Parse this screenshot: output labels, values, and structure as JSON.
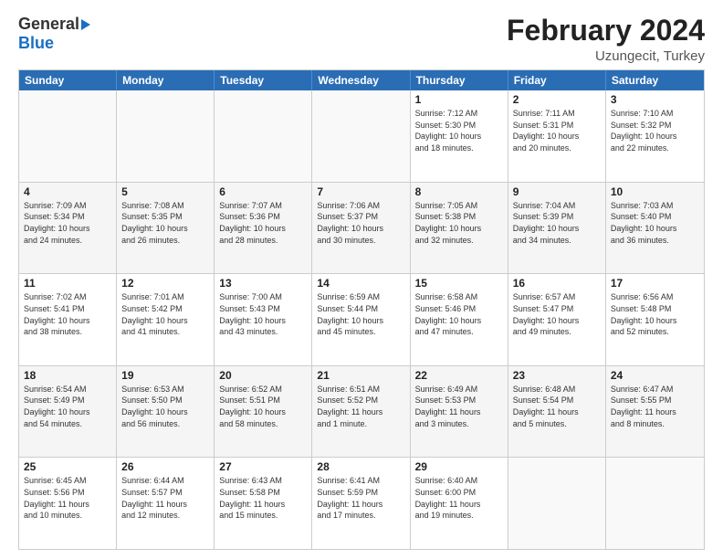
{
  "logo": {
    "general": "General",
    "blue": "Blue"
  },
  "title": "February 2024",
  "subtitle": "Uzungecit, Turkey",
  "days_of_week": [
    "Sunday",
    "Monday",
    "Tuesday",
    "Wednesday",
    "Thursday",
    "Friday",
    "Saturday"
  ],
  "weeks": [
    [
      {
        "day": "",
        "info": ""
      },
      {
        "day": "",
        "info": ""
      },
      {
        "day": "",
        "info": ""
      },
      {
        "day": "",
        "info": ""
      },
      {
        "day": "1",
        "info": "Sunrise: 7:12 AM\nSunset: 5:30 PM\nDaylight: 10 hours\nand 18 minutes."
      },
      {
        "day": "2",
        "info": "Sunrise: 7:11 AM\nSunset: 5:31 PM\nDaylight: 10 hours\nand 20 minutes."
      },
      {
        "day": "3",
        "info": "Sunrise: 7:10 AM\nSunset: 5:32 PM\nDaylight: 10 hours\nand 22 minutes."
      }
    ],
    [
      {
        "day": "4",
        "info": "Sunrise: 7:09 AM\nSunset: 5:34 PM\nDaylight: 10 hours\nand 24 minutes."
      },
      {
        "day": "5",
        "info": "Sunrise: 7:08 AM\nSunset: 5:35 PM\nDaylight: 10 hours\nand 26 minutes."
      },
      {
        "day": "6",
        "info": "Sunrise: 7:07 AM\nSunset: 5:36 PM\nDaylight: 10 hours\nand 28 minutes."
      },
      {
        "day": "7",
        "info": "Sunrise: 7:06 AM\nSunset: 5:37 PM\nDaylight: 10 hours\nand 30 minutes."
      },
      {
        "day": "8",
        "info": "Sunrise: 7:05 AM\nSunset: 5:38 PM\nDaylight: 10 hours\nand 32 minutes."
      },
      {
        "day": "9",
        "info": "Sunrise: 7:04 AM\nSunset: 5:39 PM\nDaylight: 10 hours\nand 34 minutes."
      },
      {
        "day": "10",
        "info": "Sunrise: 7:03 AM\nSunset: 5:40 PM\nDaylight: 10 hours\nand 36 minutes."
      }
    ],
    [
      {
        "day": "11",
        "info": "Sunrise: 7:02 AM\nSunset: 5:41 PM\nDaylight: 10 hours\nand 38 minutes."
      },
      {
        "day": "12",
        "info": "Sunrise: 7:01 AM\nSunset: 5:42 PM\nDaylight: 10 hours\nand 41 minutes."
      },
      {
        "day": "13",
        "info": "Sunrise: 7:00 AM\nSunset: 5:43 PM\nDaylight: 10 hours\nand 43 minutes."
      },
      {
        "day": "14",
        "info": "Sunrise: 6:59 AM\nSunset: 5:44 PM\nDaylight: 10 hours\nand 45 minutes."
      },
      {
        "day": "15",
        "info": "Sunrise: 6:58 AM\nSunset: 5:46 PM\nDaylight: 10 hours\nand 47 minutes."
      },
      {
        "day": "16",
        "info": "Sunrise: 6:57 AM\nSunset: 5:47 PM\nDaylight: 10 hours\nand 49 minutes."
      },
      {
        "day": "17",
        "info": "Sunrise: 6:56 AM\nSunset: 5:48 PM\nDaylight: 10 hours\nand 52 minutes."
      }
    ],
    [
      {
        "day": "18",
        "info": "Sunrise: 6:54 AM\nSunset: 5:49 PM\nDaylight: 10 hours\nand 54 minutes."
      },
      {
        "day": "19",
        "info": "Sunrise: 6:53 AM\nSunset: 5:50 PM\nDaylight: 10 hours\nand 56 minutes."
      },
      {
        "day": "20",
        "info": "Sunrise: 6:52 AM\nSunset: 5:51 PM\nDaylight: 10 hours\nand 58 minutes."
      },
      {
        "day": "21",
        "info": "Sunrise: 6:51 AM\nSunset: 5:52 PM\nDaylight: 11 hours\nand 1 minute."
      },
      {
        "day": "22",
        "info": "Sunrise: 6:49 AM\nSunset: 5:53 PM\nDaylight: 11 hours\nand 3 minutes."
      },
      {
        "day": "23",
        "info": "Sunrise: 6:48 AM\nSunset: 5:54 PM\nDaylight: 11 hours\nand 5 minutes."
      },
      {
        "day": "24",
        "info": "Sunrise: 6:47 AM\nSunset: 5:55 PM\nDaylight: 11 hours\nand 8 minutes."
      }
    ],
    [
      {
        "day": "25",
        "info": "Sunrise: 6:45 AM\nSunset: 5:56 PM\nDaylight: 11 hours\nand 10 minutes."
      },
      {
        "day": "26",
        "info": "Sunrise: 6:44 AM\nSunset: 5:57 PM\nDaylight: 11 hours\nand 12 minutes."
      },
      {
        "day": "27",
        "info": "Sunrise: 6:43 AM\nSunset: 5:58 PM\nDaylight: 11 hours\nand 15 minutes."
      },
      {
        "day": "28",
        "info": "Sunrise: 6:41 AM\nSunset: 5:59 PM\nDaylight: 11 hours\nand 17 minutes."
      },
      {
        "day": "29",
        "info": "Sunrise: 6:40 AM\nSunset: 6:00 PM\nDaylight: 11 hours\nand 19 minutes."
      },
      {
        "day": "",
        "info": ""
      },
      {
        "day": "",
        "info": ""
      }
    ]
  ]
}
